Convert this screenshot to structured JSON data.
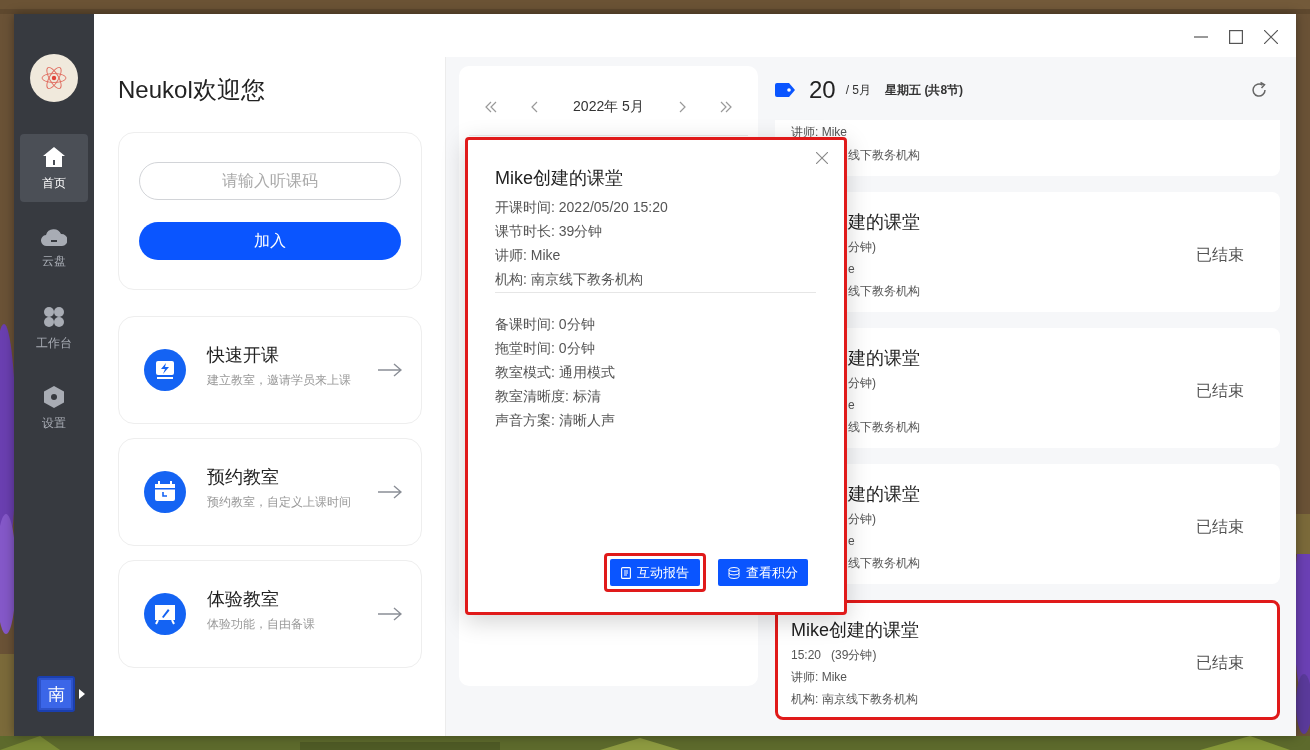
{
  "sidebar": {
    "nav": [
      {
        "label": "首页",
        "selected": true
      },
      {
        "label": "云盘",
        "selected": false
      },
      {
        "label": "工作台",
        "selected": false
      },
      {
        "label": "设置",
        "selected": false
      }
    ],
    "user": {
      "initial": "南"
    }
  },
  "welcome": {
    "title": "Neukol欢迎您"
  },
  "join": {
    "placeholder": "请输入听课码",
    "button": "加入"
  },
  "features": [
    {
      "title": "快速开课",
      "subtitle": "建立教室，邀请学员来上课"
    },
    {
      "title": "预约教室",
      "subtitle": "预约教室，自定义上课时间"
    },
    {
      "title": "体验教室",
      "subtitle": "体验功能，自由备课"
    }
  ],
  "calendar": {
    "month": "2022年 5月"
  },
  "schedule": {
    "day": "20",
    "month": "/ 5月",
    "weekday": "星期五 (共8节)",
    "cards": [
      {
        "highlighted": false,
        "lines": [
          {
            "kind": "teacher",
            "text": "讲师: Mike"
          },
          {
            "kind": "org",
            "text": "线下教务机构",
            "covered": true
          }
        ]
      },
      {
        "highlighted": false,
        "status": "已结束",
        "lines": [
          {
            "kind": "title",
            "text": "建的课堂",
            "covered": true
          },
          {
            "kind": "time",
            "text": "分钟)",
            "covered": true
          },
          {
            "kind": "teacher",
            "text": "e",
            "covered": true
          },
          {
            "kind": "org",
            "text": "线下教务机构",
            "covered": true
          }
        ]
      },
      {
        "highlighted": false,
        "status": "已结束",
        "lines": [
          {
            "kind": "title",
            "text": "建的课堂",
            "covered": true
          },
          {
            "kind": "time",
            "text": "分钟)",
            "covered": true
          },
          {
            "kind": "teacher",
            "text": "e",
            "covered": true
          },
          {
            "kind": "org",
            "text": "线下教务机构",
            "covered": true
          }
        ]
      },
      {
        "highlighted": false,
        "status": "已结束",
        "lines": [
          {
            "kind": "title",
            "text": "建的课堂",
            "covered": true
          },
          {
            "kind": "time",
            "text": "分钟)",
            "covered": true
          },
          {
            "kind": "teacher",
            "text": "e",
            "covered": true
          },
          {
            "kind": "org",
            "text": "线下教务机构",
            "covered": true
          }
        ]
      },
      {
        "highlighted": true,
        "status": "已结束",
        "lines": [
          {
            "kind": "title",
            "text": "Mike创建的课堂"
          },
          {
            "kind": "time",
            "text": "15:20   (39分钟)"
          },
          {
            "kind": "teacher",
            "text": "讲师: Mike"
          },
          {
            "kind": "org",
            "text": "机构: 南京线下教务机构"
          }
        ]
      }
    ]
  },
  "dialog": {
    "highlighted": true,
    "title": "Mike创建的课堂",
    "info": [
      "开课时间: 2022/05/20 15:20",
      "课节时长: 39分钟",
      "讲师: Mike",
      "机构: 南京线下教务机构"
    ],
    "settings": [
      "备课时间: 0分钟",
      "拖堂时间: 0分钟",
      "教室模式: 通用模式",
      "教室清晰度: 标清",
      "声音方案: 清晰人声"
    ],
    "buttons": [
      {
        "label": "互动报告",
        "highlighted": true
      },
      {
        "label": "查看积分",
        "highlighted": false
      }
    ]
  }
}
